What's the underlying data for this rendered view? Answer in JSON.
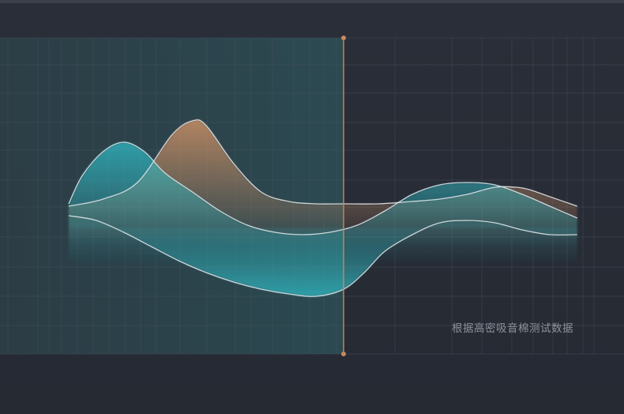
{
  "caption": "根据高密吸音棉测试数据",
  "colors": {
    "background": "#272b34",
    "grid": "#4a5562",
    "teal": "#2fb3bd",
    "copper": "#d19366",
    "cursor": "#c8895e",
    "line": "#dfe3e8"
  },
  "chart_data": {
    "type": "area",
    "title": "",
    "xlabel": "",
    "ylabel": "",
    "grid": true,
    "x_range": [
      0,
      100
    ],
    "y_range": [
      0,
      100
    ],
    "cursor_x": 50,
    "series": [
      {
        "color": "copper",
        "x": [
          10,
          15,
          20,
          25,
          28,
          30,
          34,
          38,
          42,
          46,
          50,
          55,
          60,
          64,
          68,
          72,
          75,
          77,
          80,
          84
        ],
        "y": [
          37,
          40,
          47,
          67,
          73,
          71,
          55,
          43,
          39,
          38,
          38,
          38,
          39,
          40,
          42,
          45,
          45,
          44,
          41,
          37
        ]
      },
      {
        "color": "teal",
        "x": [
          10,
          12,
          15,
          18,
          21,
          24,
          28,
          32,
          36,
          40,
          44,
          48,
          52,
          56,
          60,
          64,
          68,
          72,
          76,
          80,
          84
        ],
        "y": [
          38,
          50,
          60,
          64,
          60,
          51,
          43,
          35,
          29,
          26,
          25,
          26,
          29,
          35,
          42,
          46,
          47,
          46,
          42,
          37,
          32
        ]
      },
      {
        "color": "teal",
        "x": [
          10,
          14,
          18,
          22,
          26,
          30,
          34,
          38,
          42,
          46,
          50,
          53,
          56,
          60,
          64,
          68,
          72,
          76,
          80,
          84
        ],
        "y": [
          33,
          31,
          26,
          20,
          14,
          9,
          5,
          2,
          0,
          -1,
          2,
          9,
          18,
          25,
          30,
          31,
          30,
          27,
          25,
          25
        ]
      }
    ]
  }
}
